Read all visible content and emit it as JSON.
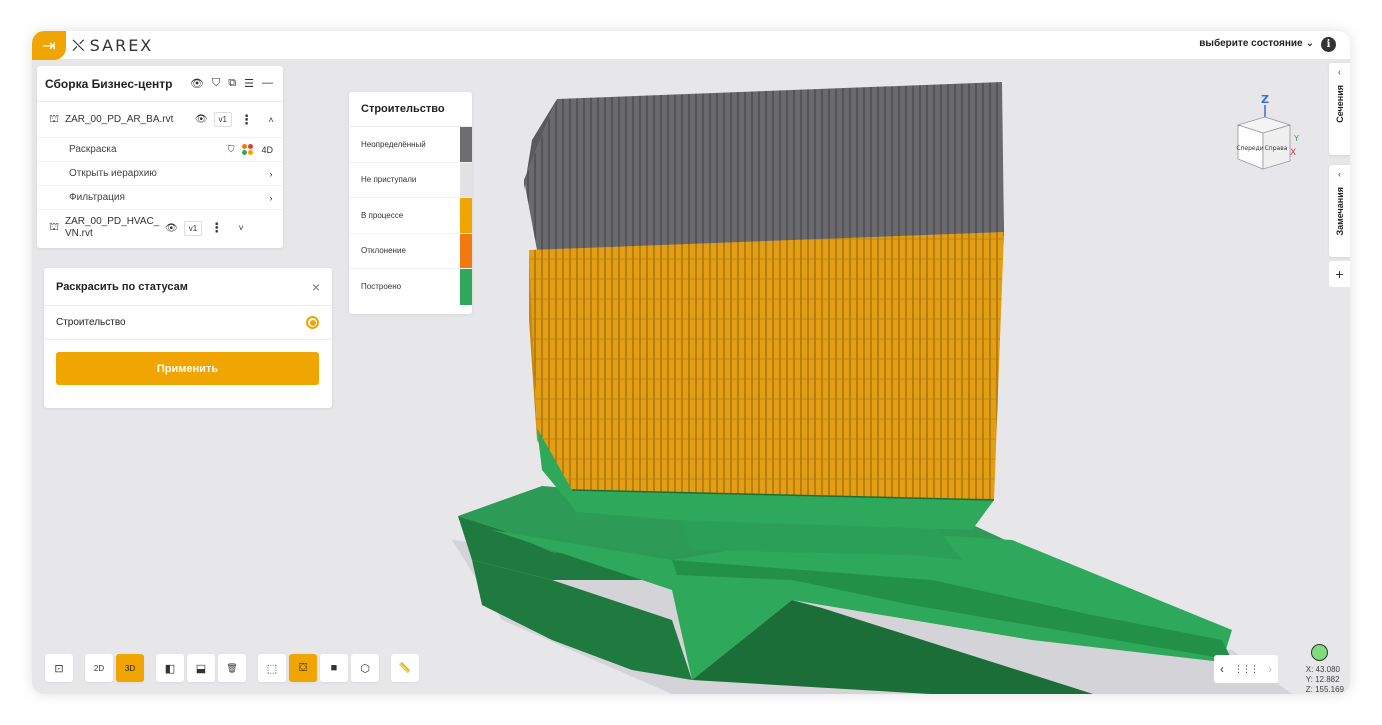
{
  "app": {
    "logo_mark": "⛌",
    "logo_text": "SAREX",
    "exit_icon": "exit-icon",
    "state_select_label": "выберите состояние",
    "info_label": "i"
  },
  "model_panel": {
    "title": "Сборка Бизнес-центр",
    "header_icons": [
      "eye-icon",
      "paint-roller-icon",
      "add-layer-icon",
      "sliders-icon",
      "minimize-icon"
    ],
    "files": [
      {
        "name": "ZAR_00_PD_AR_BA.rvt",
        "version": "v1",
        "expanded": true
      },
      {
        "name": "ZAR_00_PD_HVAC_VN.rvt",
        "version": "v1",
        "expanded": false
      }
    ],
    "sub_items": {
      "coloring": "Раскраска",
      "coloring_4d": "4D",
      "hierarchy": "Открыть иерархию",
      "filter": "Фильтрация"
    },
    "chevron_right": "›",
    "chevron_up": "˄",
    "chevron_down": "˅",
    "kebab": "⋮"
  },
  "color_panel": {
    "title": "Раскрасить по статусам",
    "close": "×",
    "option": "Строительство",
    "option_selected": true,
    "apply": "Применить"
  },
  "legend": {
    "title": "Строительство",
    "items": [
      {
        "label": "Неопределённый",
        "color": "#6e6e72"
      },
      {
        "label": "Не приступали",
        "color": "#e2e2e2"
      },
      {
        "label": "В процессе",
        "color": "#f0a500"
      },
      {
        "label": "Отклонение",
        "color": "#f07a10"
      },
      {
        "label": "Построено",
        "color": "#2ea85a"
      }
    ]
  },
  "right_tabs": {
    "sections": "Сечения",
    "remarks": "Замечания",
    "chevron": "‹",
    "add": "+"
  },
  "navcube": {
    "axis_z": "Z",
    "axis_y": "Y",
    "axis_x": "X",
    "front": "Спереди",
    "right": "Справа"
  },
  "toolbar": {
    "buttons": [
      {
        "icon": "focus-icon",
        "label": "⊡",
        "active": false
      },
      {
        "icon": "view-2d-icon",
        "label": "2D",
        "active": false
      },
      {
        "icon": "view-3d-icon",
        "label": "3D",
        "active": true
      },
      {
        "icon": "section-vertical-icon",
        "label": "◧",
        "active": false
      },
      {
        "icon": "section-horizontal-icon",
        "label": "⬓",
        "active": false
      },
      {
        "icon": "trash-icon",
        "label": "🗑",
        "active": false
      },
      {
        "icon": "select-box-icon",
        "label": "⬚",
        "active": false
      },
      {
        "icon": "colorize-icon",
        "label": "⛋",
        "active": true
      },
      {
        "icon": "camera-icon",
        "label": "■",
        "active": false
      },
      {
        "icon": "cube-icon",
        "label": "⬡",
        "active": false
      },
      {
        "icon": "ruler-icon",
        "label": "📏",
        "active": false
      }
    ]
  },
  "pager": {
    "prev": "‹",
    "grid": "⋮⋮⋮",
    "next": "›"
  },
  "coords": {
    "x": "X: 43.080",
    "y": "Y: 12.882",
    "z": "Z: 155.169"
  },
  "colors": {
    "accent": "#f0a500",
    "grey_status": "#6e6e72",
    "in_progress": "#e8a010",
    "built": "#2ea85a"
  }
}
